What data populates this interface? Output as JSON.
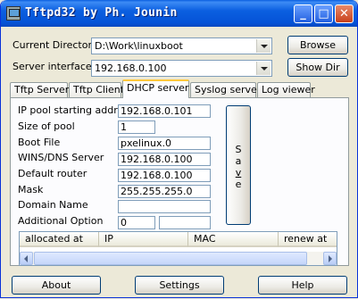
{
  "window": {
    "title": "Tftpd32 by Ph. Jounin",
    "minimize_glyph": "_",
    "maximize_glyph": "□",
    "close_glyph": "✕",
    "icon": "tftpd-app-icon"
  },
  "top": {
    "current_directory_label": "Current Directory",
    "current_directory_value": "D:\\Work\\linuxboot",
    "server_interfaces_label": "Server interfaces",
    "server_interfaces_value": "192.168.0.100",
    "browse_label": "Browse",
    "show_dir_label": "Show Dir"
  },
  "tabs": [
    {
      "label": "Tftp Server",
      "active": false
    },
    {
      "label": "Tftp Client",
      "active": false
    },
    {
      "label": "DHCP server",
      "active": true
    },
    {
      "label": "Syslog server",
      "active": false
    },
    {
      "label": "Log viewer",
      "active": false
    }
  ],
  "dhcp": {
    "fields": [
      {
        "label": "IP pool starting address",
        "value": "192.168.0.101"
      },
      {
        "label": "Size of pool",
        "value": "1"
      },
      {
        "label": "Boot File",
        "value": "pxelinux.0"
      },
      {
        "label": "WINS/DNS Server",
        "value": "192.168.0.100"
      },
      {
        "label": "Default router",
        "value": "192.168.0.100"
      },
      {
        "label": "Mask",
        "value": "255.255.255.0"
      },
      {
        "label": "Domain Name",
        "value": ""
      },
      {
        "label": "Additional Option",
        "value": "0",
        "value2": ""
      }
    ],
    "save_letters": [
      "S",
      "a",
      "v",
      "e"
    ],
    "columns": [
      "allocated at",
      "IP",
      "MAC",
      "renew at"
    ]
  },
  "footer": {
    "about_label": "About",
    "settings_label": "Settings",
    "help_label": "Help"
  }
}
